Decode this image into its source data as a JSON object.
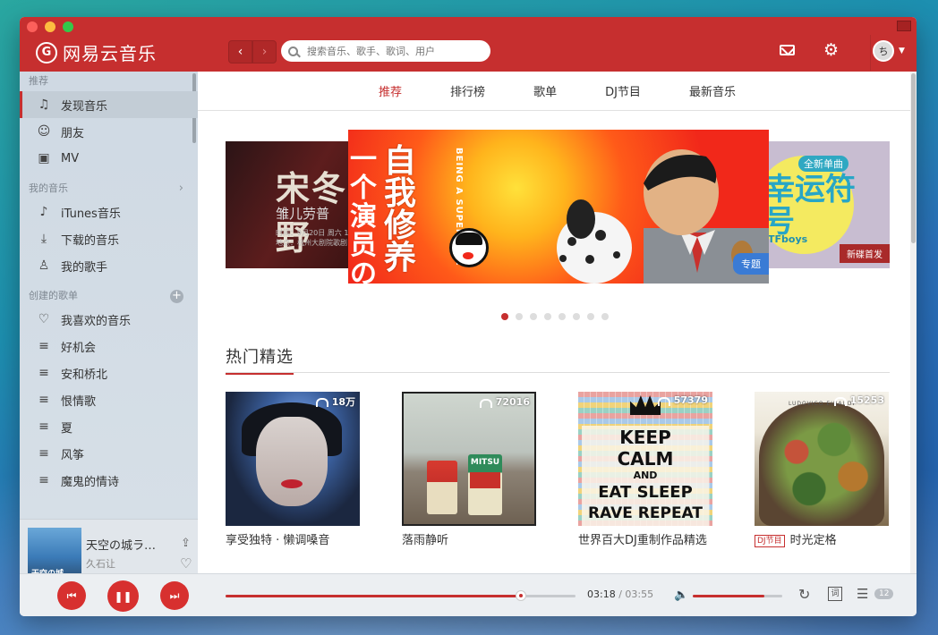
{
  "app": {
    "name": "网易云音乐",
    "logo_glyph": "G"
  },
  "header": {
    "back_glyph": "‹",
    "forward_glyph": "›",
    "search_placeholder": "搜索音乐、歌手、歌词、用户",
    "avatar_initial": "ち",
    "icons": [
      "mail-icon",
      "gear-icon",
      "chevron-down-icon"
    ]
  },
  "sidebar": {
    "sections": [
      {
        "title": "推荐",
        "items": [
          {
            "label": "发现音乐",
            "icon": "♫",
            "active": true
          },
          {
            "label": "朋友",
            "icon": "☺"
          },
          {
            "label": "MV",
            "icon": "▣"
          }
        ]
      },
      {
        "title": "我的音乐",
        "action": "›",
        "items": [
          {
            "label": "iTunes音乐",
            "icon": "♪"
          },
          {
            "label": "下载的音乐",
            "icon": "⤓"
          },
          {
            "label": "我的歌手",
            "icon": "♙"
          }
        ]
      },
      {
        "title": "创建的歌单",
        "action": "+",
        "items": [
          {
            "label": "我喜欢的音乐",
            "icon": "♡"
          },
          {
            "label": "好机会",
            "icon": "≡"
          },
          {
            "label": "安和桥北",
            "icon": "≡"
          },
          {
            "label": "恨情歌",
            "icon": "≡"
          },
          {
            "label": "夏",
            "icon": "≡"
          },
          {
            "label": "风筝",
            "icon": "≡"
          },
          {
            "label": "魔鬼的情诗",
            "icon": "≡"
          }
        ]
      }
    ]
  },
  "now_playing": {
    "title": "天空の城ラ…",
    "artist": "久石让",
    "cover_text": "天空の城"
  },
  "tabs": [
    {
      "label": "推荐",
      "active": true
    },
    {
      "label": "排行榜"
    },
    {
      "label": "歌单"
    },
    {
      "label": "DJ节目"
    },
    {
      "label": "最新音乐"
    }
  ],
  "banners": {
    "left": {
      "title": "宋冬野",
      "subtitle": "雏儿劳普",
      "small": "时间：9月20日 周六 19\n地点：杭州大剧院歌剧"
    },
    "center": {
      "col1": "自我修养",
      "col2": "一个演员の",
      "english": "BEING A SUPERSTAR",
      "badge": "专题"
    },
    "right": {
      "tag": "全新单曲",
      "title": "幸运符号",
      "artist": "TFboys",
      "badge": "新碟首发"
    },
    "dots_count": 8,
    "active_dot": 0
  },
  "hot_section": {
    "title": "热门精选",
    "cards": [
      {
        "title": "享受独特 · 懒调嗓音",
        "plays": "18万"
      },
      {
        "title": "落雨静听",
        "plays": "72016",
        "cover_text": "MITSU"
      },
      {
        "title": "世界百大DJ重制作品精选",
        "plays": "57379",
        "cover_lines": [
          "KEEP",
          "CALM",
          "AND",
          "EAT SLEEP",
          "RAVE REPEAT"
        ]
      },
      {
        "title": "时光定格",
        "plays": "15253",
        "tag": "DJ节目",
        "cover_label": "LUDOVICO EINAUDI"
      }
    ]
  },
  "player": {
    "current_time": "03:18",
    "total_time": "03:55",
    "progress": 0.845,
    "volume": 0.8,
    "playlist_count": "12",
    "lyric_glyph": "词"
  }
}
